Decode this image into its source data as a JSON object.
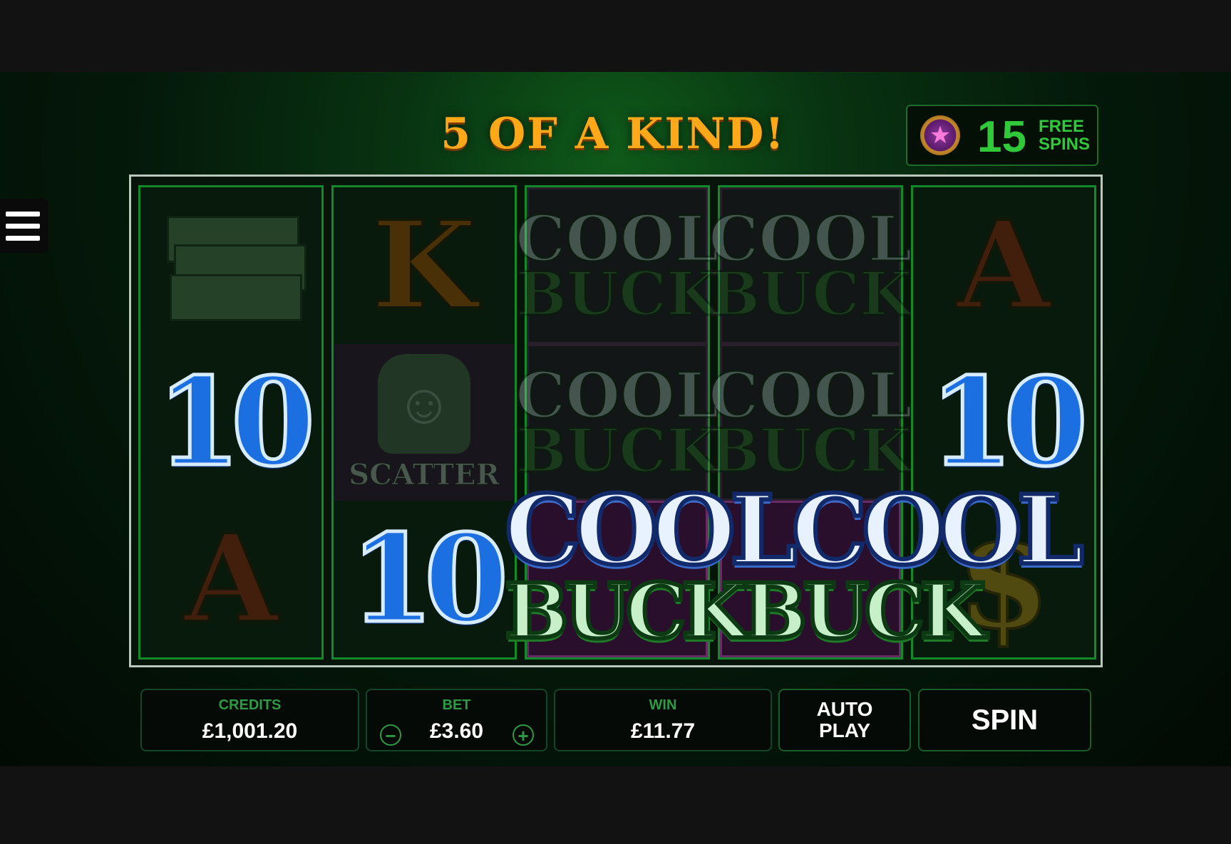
{
  "game": {
    "headline": "5 OF A KIND!",
    "free_spins": {
      "count": "15",
      "label": "FREE SPINS"
    },
    "big_win_line1": "COOLCOOL",
    "big_win_line2": "BUCKBUCK",
    "scatter_label": "SCATTER",
    "symbols": {
      "king": "K",
      "ace": "A",
      "ten": "10",
      "cool": "COOL",
      "buck": "BUCK",
      "dollar": "$"
    }
  },
  "controls": {
    "credits_label": "CREDITS",
    "credits_value": "£1,001.20",
    "bet_label": "BET",
    "bet_value": "£3.60",
    "bet_minus": "−",
    "bet_plus": "+",
    "win_label": "WIN",
    "win_value": "£11.77",
    "autoplay_label": "AUTO PLAY",
    "spin_label": "SPIN"
  },
  "colors": {
    "headline": "#ffa81a",
    "free_spins": "#2fc93a",
    "reel_border": "#128a2a",
    "panel_label": "#2f9a45"
  }
}
